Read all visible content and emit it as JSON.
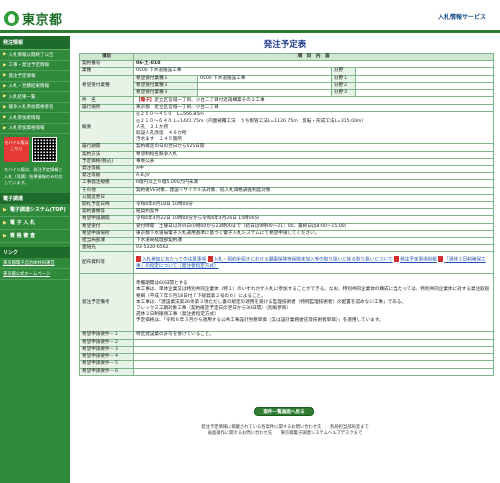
{
  "header": {
    "logo_text": "東京都",
    "right_title": "入札情報サービス"
  },
  "sidebar": {
    "heading": "発注情報",
    "items": [
      "入札情報公開終了公告",
      "工事・発注予定情報",
      "発注予定情報",
      "入札・見積結果情報",
      "入札結果一覧",
      "競争入札参加資格者名",
      "入札参加者情報",
      "入札参加資格情報"
    ],
    "mobile_badge": "モバイル版はこちら",
    "mobile_note": "モバイル版は、発注予定情報と入札（見積）結果情報のみ対応しています。",
    "sub_heading": "電子調達",
    "buttons": [
      "電子調達システム(TOP)",
      "電 子 入 札",
      "資 格 審 査"
    ],
    "link_heading": "リンク",
    "links": [
      "東京都電子自治体共同運営",
      "東京都公式ホームページ"
    ]
  },
  "main": {
    "title": "発注予定表",
    "col_item": "項目",
    "col_content": "項　目　内　容",
    "rows": {
      "contract_no_label": "契約番号",
      "contract_no": "06-土-010",
      "industry_label": "業種",
      "industry": "0500 下水道施設工事",
      "bunki_label": "分野",
      "desired_label": "希望受付業種",
      "desired_1_label": "希望受付業種１",
      "desired_1": "0500 下水道施設工事",
      "desired_2_label": "希望受付業種２",
      "desired_3_label": "希望受付業種３",
      "bunki_1": "分野１",
      "bunki_2": "分野２",
      "bunki_3": "分野３",
      "name_label": "件　名",
      "name_tag": "【電子】",
      "name": "足立区宮城一丁目、小台二丁目付近再構築その２工事",
      "place_label": "履行場所",
      "place": "東京都　足立区宮城一丁目、小台二丁目",
      "summary_label": "概要",
      "summary_1": "◎２５０～４５０　L=566.85m",
      "summary_2": "◎２１０～６４０ L=1441.75m（内面被覆工法　うち製管工法L=1126.75m　反転・形成工法L=315.00m）",
      "summary_3": "人孔　２１か所",
      "summary_4": "既設人孔改造　４６か所",
      "summary_5": "汚水ます　１４５箇所",
      "period_label": "履行期間",
      "period": "契約確定の日の翌日から525日間",
      "method_label": "契約方法",
      "method": "希望制指名競争入札",
      "price_label": "予定価格(税込)",
      "price": "事後公表",
      "level_label": "発注等級",
      "level": "A中",
      "rank_label": "発注等級",
      "rank": "A,B,JV",
      "scale_label": "工事発注規模",
      "scale": "6億円以上６億5,000万円未満",
      "other_label": "その他",
      "other": "契約後VE対象、建設リサイクル法対象、低入札価格調査制度対象",
      "announce_label": "公開変更日",
      "announce": "",
      "open_label": "開札予定日時",
      "open": "令和6年6月18日 10時00分",
      "contact_method_label": "契約書類等",
      "contact_method": "紙契約案件",
      "apply_period_label": "希望申請期間",
      "apply_period": "令和6年4月22日 10時00分から令和6年4月26日 15時00分",
      "apply_hours_label": "希望受付",
      "apply_hours": "受付時間　土曜日以外の日(0時00から23時00まで（初日は9時00～21：00、最終日は8:00～15:00）",
      "apply_place_label": "希望申請場所",
      "apply_place": "東京都下水道局電子入札運用基準に基づく電子入札システムにて希望申請してください。",
      "dept_label": "担当局部課",
      "dept": "下水道局経理部契約課",
      "tel_label": "連絡先",
      "tel": "03-5320-6562",
      "docs_label": "配布資料等",
      "doc_1": "入札参加にあたっての注意事項",
      "doc_2": "入札・契約手続きにおける健康保険等保険未加入等の取り扱いに係る取り扱いについて",
      "doc_3": "発注予定事項別紙",
      "doc_4": "「週休２日制確保工事」の指定について（発注者指定方式）",
      "notes_label": "発注予定備考",
      "note_1": "準備期間は60日間とする",
      "note_2": "本工事は、単体企業又は特別共同企業体（特１）のいずれかが入札に参加することができる。なお、特別共同企業体の構成に当たっては、特別共同企業体に対する発注取扱要綱（平成７年５月18日付７下総発第２号の６）によること。",
      "note_3": "本工事は、「建設業法第26条第３項ただし書の規定の適用を受ける監理技術者（特例監理技術者）の配置を認めない工事」である。",
      "note_4": "フレックス工期対象工事（契約確定予定日の翌日から30日間）（別紙参照）",
      "note_5": "週休２日制確保工事（発注者指定方式）",
      "note_6": "予定価格は、「令和６年３月から適用する公共工事設計労務単価（又は設計業務委託等技術者単価）」を適用しています。",
      "req_label_1": "希望申請要件－１",
      "req_1": "特定建設業の許可を受けていること。",
      "req_label_2": "希望申請要件－２",
      "req_label_3": "希望申請要件－３",
      "req_label_4": "希望申請要件－４",
      "req_label_5": "希望申請要件－５",
      "req_label_6": "希望申請要件－６"
    },
    "back_button": "案件一覧画面へ戻る"
  },
  "footer": {
    "line_1": "発注予定情報に掲載されている各案件に関するお問い合わせ先　　各局担当部局室まで",
    "line_2": "画面操作に関するお問い合わせ先　　東京都電子調達システムヘルプデスクまで"
  }
}
